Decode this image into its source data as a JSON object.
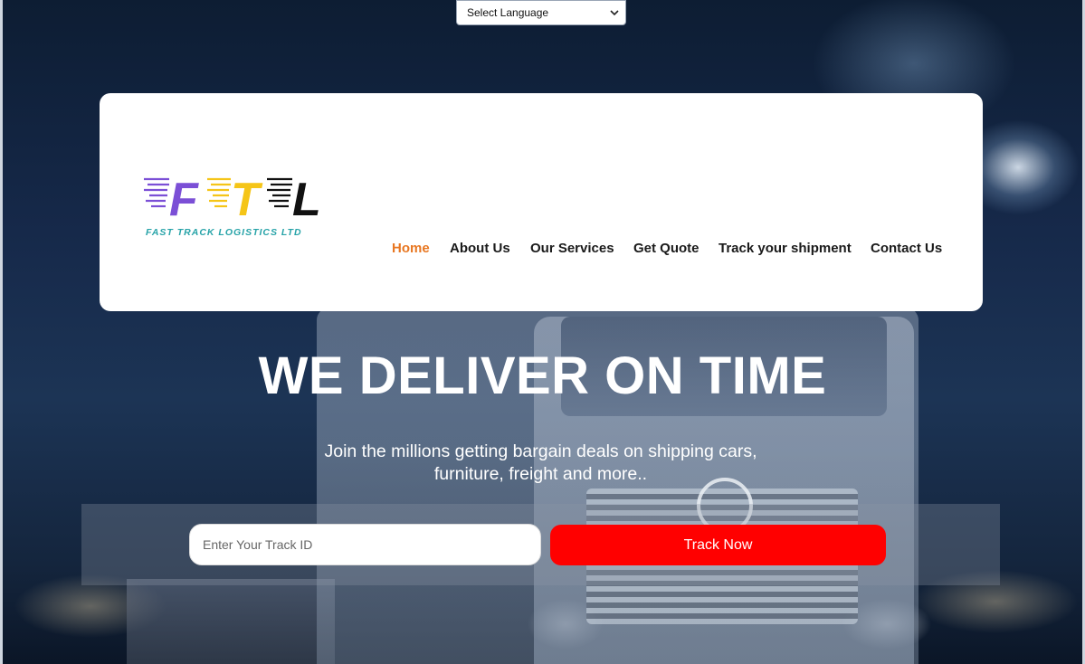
{
  "language_selector": {
    "selected": "Select Language"
  },
  "logo": {
    "letters": [
      "F",
      "T",
      "L"
    ],
    "tagline": "FAST TRACK LOGISTICS LTD"
  },
  "nav": {
    "items": [
      {
        "label": "Home",
        "active": true
      },
      {
        "label": "About Us"
      },
      {
        "label": "Our Services"
      },
      {
        "label": "Get Quote"
      },
      {
        "label": "Track your shipment"
      },
      {
        "label": "Contact Us"
      }
    ]
  },
  "hero": {
    "title": "WE DELIVER ON TIME",
    "subtitle_line1": "Join the millions getting bargain deals on shipping cars,",
    "subtitle_line2": "furniture, freight and more.."
  },
  "tracking": {
    "placeholder": "Enter Your Track ID",
    "value": "",
    "button_label": "Track Now"
  },
  "colors": {
    "accent_active_nav": "#e87722",
    "track_button": "#ff0000",
    "logo_f": "#7b4fd6",
    "logo_t": "#f5c518",
    "logo_l": "#111111",
    "logo_tagline": "#27a3a8"
  }
}
